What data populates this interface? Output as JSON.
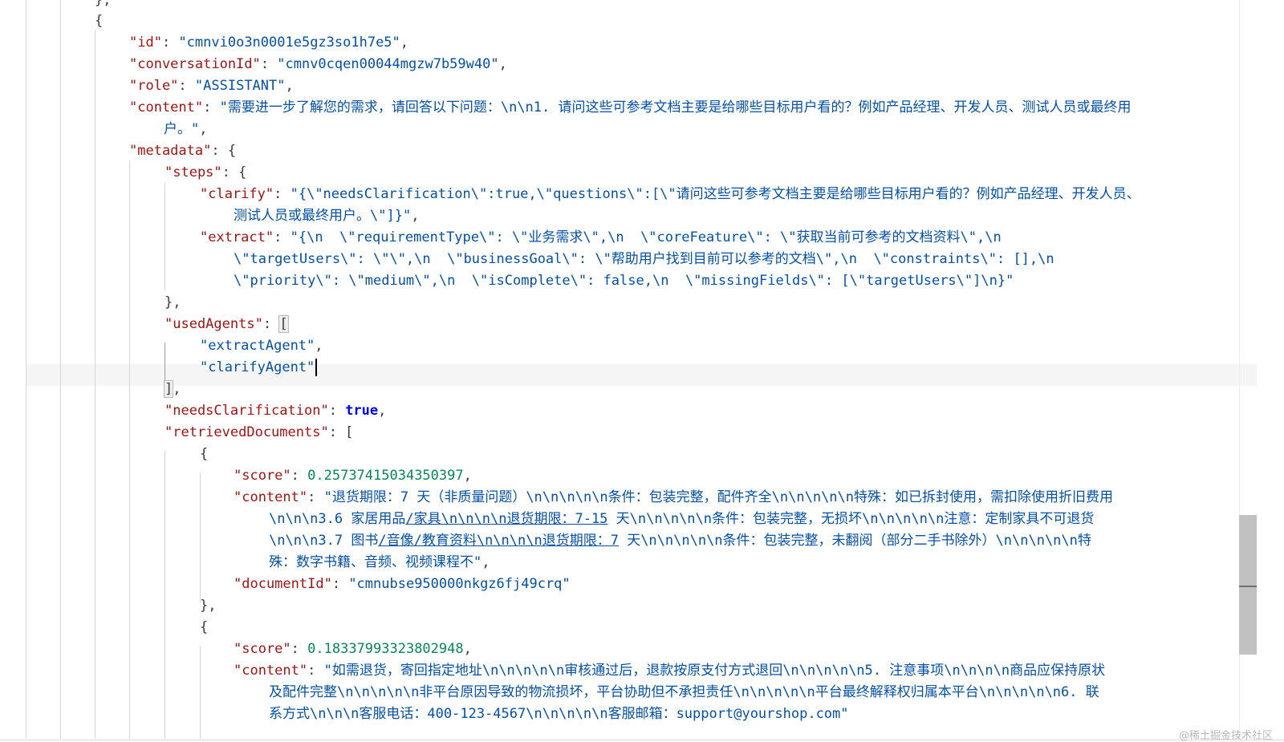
{
  "editor": {
    "prev_close": "},",
    "obj_open": "{",
    "id_key": "\"id\"",
    "id_val": "\"cmnvi0o3n0001e5gz3so1h7e5\"",
    "conv_key": "\"conversationId\"",
    "conv_val": "\"cmnv0cqen00044mgzw7b59w40\"",
    "role_key": "\"role\"",
    "role_val": "\"ASSISTANT\"",
    "content_key": "\"content\"",
    "content_val_1": "\"需要进一步了解您的需求，请回答以下问题：\\n\\n1. 请问这些可参考文档主要是给哪些目标用户看的？例如产品经理、开发人员、测试人员或最终用",
    "content_val_2": "户。\"",
    "metadata_key": "\"metadata\"",
    "steps_key": "\"steps\"",
    "clarify_key": "\"clarify\"",
    "clarify_val_1": "\"{\\\"needsClarification\\\":true,\\\"questions\\\":[\\\"请问这些可参考文档主要是给哪些目标用户看的？例如产品经理、开发人员、",
    "clarify_val_2": "测试人员或最终用户。\\\"]}\"",
    "extract_key": "\"extract\"",
    "extract_val_1": "\"{\\n  \\\"requirementType\\\": \\\"业务需求\\\",\\n  \\\"coreFeature\\\": \\\"获取当前可参考的文档资料\\\",\\n",
    "extract_val_2": "\\\"targetUsers\\\": \\\"\\\",\\n  \\\"businessGoal\\\": \\\"帮助用户找到目前可以参考的文档\\\",\\n  \\\"constraints\\\": [],\\n",
    "extract_val_3": "\\\"priority\\\": \\\"medium\\\",\\n  \\\"isComplete\\\": false,\\n  \\\"missingFields\\\": [\\\"targetUsers\\\"]\\n}\"",
    "steps_close": "},",
    "used_agents_key": "\"usedAgents\"",
    "agent_1": "\"extractAgent\"",
    "agent_2": "\"clarifyAgent\"",
    "needs_clar_key": "\"needsClarification\"",
    "needs_clar_val": "true",
    "retrieved_key": "\"retrievedDocuments\"",
    "doc1": {
      "score_key": "\"score\"",
      "score_val": "0.25737415034350397",
      "content_key": "\"content\"",
      "content_1": "\"退货期限：7 天（非质量问题）\\n\\n\\n\\n\\n条件：包装完整，配件齐全\\n\\n\\n\\n\\n特殊：如已拆封使用，需扣除使用折旧费用",
      "content_2a": "\\n\\n\\n3.6 家居用品",
      "content_2b": "/家具\\n\\n\\n\\n退货期限：7-15",
      "content_2c": " 天\\n\\n\\n\\n\\n条件：包装完整，无损坏\\n\\n\\n\\n\\n注意：定制家具不可退货",
      "content_3a": "\\n\\n\\n3.7 图书",
      "content_3b": "/音像/教育资料\\n\\n\\n\\n退货期限：7",
      "content_3c": " 天\\n\\n\\n\\n\\n条件：包装完整，未翻阅（部分二手书除外）\\n\\n\\n\\n\\n特",
      "content_4": "殊：数字书籍、音频、视频课程不\"",
      "docid_key": "\"documentId\"",
      "docid_val": "\"cmnubse950000nkgz6fj49crq\""
    },
    "doc2": {
      "score_key": "\"score\"",
      "score_val": "0.18337993323802948",
      "content_key": "\"content\"",
      "content_1": "\"如需退货，寄回指定地址\\n\\n\\n\\n\\n审核通过后，退款按原支付方式退回\\n\\n\\n\\n\\n5. 注意事项\\n\\n\\n\\n商品应保持原状",
      "content_2": "及配件完整\\n\\n\\n\\n\\n非平台原因导致的物流损坏，平台协助但不承担责任\\n\\n\\n\\n\\n平台最终解释权归属本平台\\n\\n\\n\\n\\n6. 联",
      "content_3": "系方式\\n\\n\\n客服电话：400-123-4567\\n\\n\\n\\n\\n客服邮箱：support@yourshop.com\""
    }
  },
  "watermark": "@稀土掘金技术社区",
  "colors": {
    "key": "#a31515",
    "string": "#0451a5",
    "number": "#098658",
    "boolean": "#0000ff"
  }
}
